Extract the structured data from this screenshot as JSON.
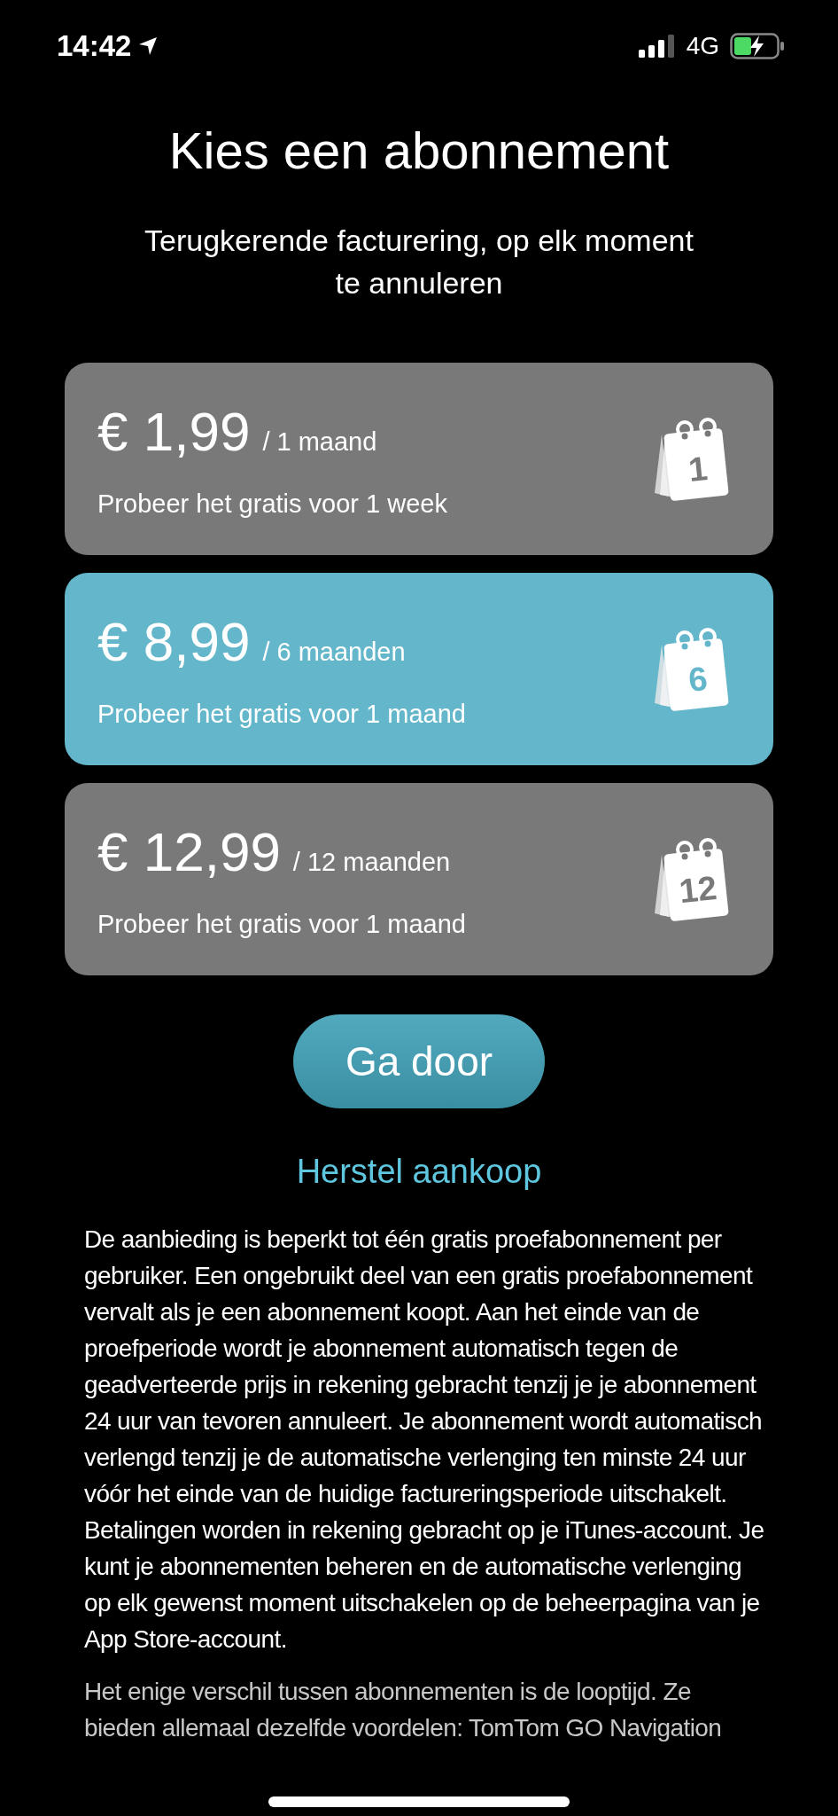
{
  "status_bar": {
    "time": "14:42",
    "network": "4G"
  },
  "title": "Kies een abonnement",
  "subtitle": "Terugkerende facturering, op elk moment te annuleren",
  "plans": [
    {
      "price": "€ 1,99",
      "period": "/ 1 maand",
      "trial": "Probeer het gratis voor 1 week",
      "icon_number": "1",
      "selected": false
    },
    {
      "price": "€ 8,99",
      "period": "/ 6 maanden",
      "trial": "Probeer het gratis voor 1 maand",
      "icon_number": "6",
      "selected": true
    },
    {
      "price": "€ 12,99",
      "period": "/ 12 maanden",
      "trial": "Probeer het gratis voor 1 maand",
      "icon_number": "12",
      "selected": false
    }
  ],
  "continue_button": "Ga door",
  "restore_link": "Herstel aankoop",
  "paragraphs": [
    "De aanbieding is beperkt tot één gratis proefabonnement per gebruiker. Een ongebruikt deel van een gratis proefabonnement vervalt als je een abonnement koopt. Aan het einde van de proefperiode wordt je abonnement automatisch tegen de geadverteerde prijs in rekening gebracht tenzij je je abonnement 24 uur van tevoren annuleert. Je abonnement wordt automatisch verlengd tenzij je de automatische verlenging ten minste 24 uur vóór het einde van de huidige factureringsperiode uitschakelt. Betalingen worden in rekening gebracht op je iTunes-account. Je kunt je abonnementen beheren en de automatische verlenging op elk gewenst moment uitschakelen op de beheerpagina van je App Store-account.",
    "Het enige verschil tussen abonnementen is de looptijd. Ze bieden allemaal dezelfde voordelen: TomTom GO Navigation"
  ]
}
